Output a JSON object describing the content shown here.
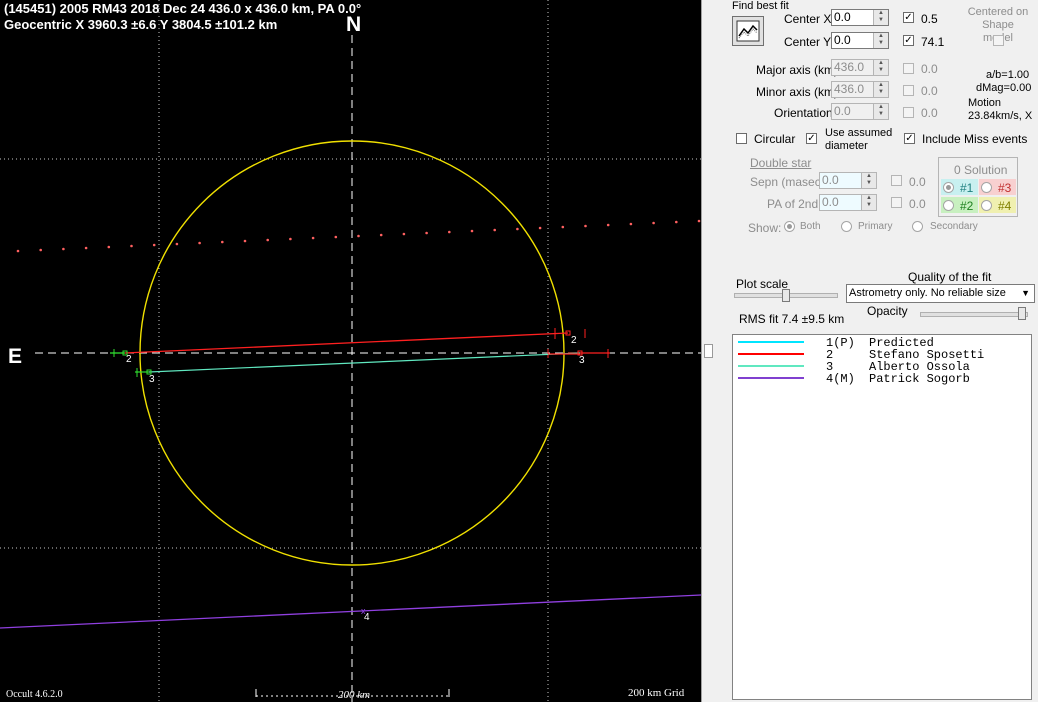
{
  "plot": {
    "title_line1": "(145451) 2005 RM43  2018 Dec 24  436.0 x 436.0 km, PA 0.0°",
    "title_line2": "Geocentric  X  3960.3 ±6.6  Y 3804.5 ±101.2 km",
    "north": "N",
    "east": "E",
    "version": "Occult 4.6.2.0",
    "scale_label": "200 km",
    "grid_label": "200 km Grid",
    "chord_labels": [
      "2",
      "2",
      "3",
      "3",
      "4"
    ],
    "colors": {
      "ellipse": "#f0e000",
      "chord_2": "#ff2020",
      "chord_3": "#60e8c0",
      "chord_4": "#9040e0",
      "path": "#ff6060"
    }
  },
  "panel": {
    "find_best_fit": "Find best fit",
    "center_x_label": "Center X",
    "center_x_value": "0.0",
    "center_y_label": "Center Y",
    "center_y_value": "0.0",
    "cx_check_value": "0.5",
    "cy_check_value": "74.1",
    "centered_on_shape": "Centered on Shape model",
    "major_axis_label": "Major axis (km)",
    "major_axis_value": "436.0",
    "minor_axis_label": "Minor axis (km)",
    "minor_axis_value": "436.0",
    "orientation_label": "Orientation",
    "orientation_value": "0.0",
    "major_check_value": "0.0",
    "minor_check_value": "0.0",
    "orient_check_value": "0.0",
    "ab_ratio": "a/b=1.00",
    "dmag": "dMag=0.00",
    "motion_label": "Motion",
    "motion_value": "23.84km/s, X",
    "circular": "Circular",
    "use_assumed_diameter": "Use assumed diameter",
    "include_miss": "Include Miss events",
    "double_star": "Double star",
    "sepn_label": "Sepn (masec)",
    "sepn_value": "0.0",
    "sepn_check_value": "0.0",
    "pa2_label": "PA of 2nd",
    "pa2_value": "0.0",
    "pa2_check_value": "0.0",
    "show_label": "Show:",
    "show_both": "Both",
    "show_primary": "Primary",
    "show_secondary": "Secondary",
    "solution_title": "0 Solution",
    "sol1": "#1",
    "sol2": "#2",
    "sol3": "#3",
    "sol4": "#4",
    "plot_scale": "Plot scale",
    "quality_label": "Quality of the fit",
    "quality_value": "Astrometry only. No reliable size",
    "opacity_label": "Opacity",
    "rms_fit": "RMS fit  7.4 ±9.5 km"
  },
  "legend": [
    {
      "num": "1(P)",
      "name": "Predicted",
      "color": "#00e5ff"
    },
    {
      "num": "2",
      "name": "Stefano Sposetti",
      "color": "#ff0000"
    },
    {
      "num": "3",
      "name": "Alberto Ossola",
      "color": "#60e8c0"
    },
    {
      "num": "4(M)",
      "name": "Patrick Sogorb",
      "color": "#8040d0"
    }
  ]
}
